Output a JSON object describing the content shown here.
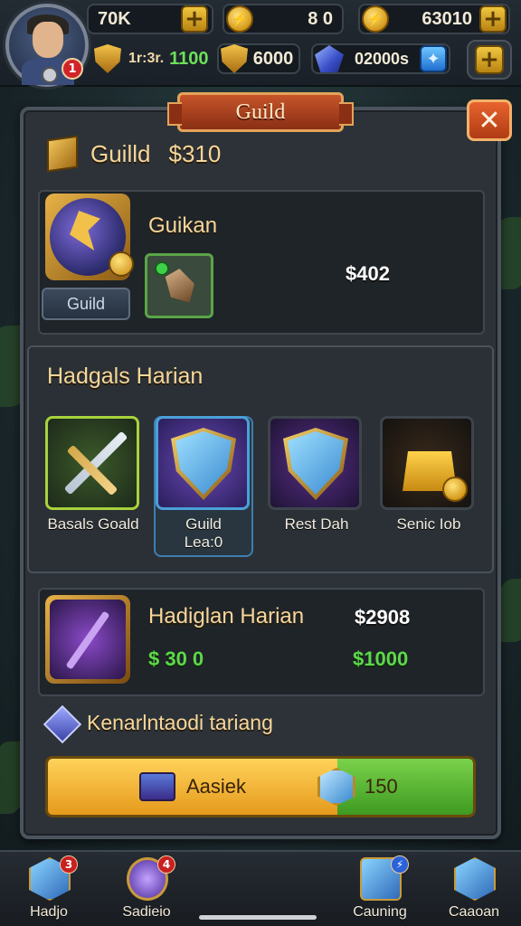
{
  "topbar": {
    "avatar_badge": "1",
    "coins_left": "70K",
    "center_value": "8 0",
    "right_value": "63010",
    "row2_left": "1r:3r.",
    "row2_left_green": "1100",
    "row2_mid": "6000",
    "row2_right": "02000s"
  },
  "panel": {
    "title": "Guild",
    "close_glyph": "✕",
    "guild_name": "Guilld",
    "guild_amount": "$310",
    "guild_sub_name": "Guikan",
    "guild_button": "Guild",
    "guild_value": "$402",
    "section_title": "Hadgals Harian",
    "rewards": [
      {
        "label": "Basals Goald"
      },
      {
        "label": "Guild",
        "sub": "Lea:0"
      },
      {
        "label": "Rest Dah"
      },
      {
        "label": "Senic Iob"
      }
    ],
    "daily": {
      "title": "Hadiglan Harian",
      "price": "$2908",
      "green_left": "$ 30  0",
      "green_right": "$1000"
    },
    "sub_heading": "Kenarlntaodi tariang",
    "action": {
      "label": "Aasiek",
      "right_value": "150"
    }
  },
  "nav": [
    {
      "label": "Hadjo",
      "badge": "3"
    },
    {
      "label": "Sadieio",
      "badge": "4"
    },
    {
      "label": "Cauning",
      "badge": "⚡"
    },
    {
      "label": "Caaoan",
      "badge": ""
    }
  ],
  "colors": {
    "accent_gold": "#f6d69a",
    "title_plate": "#c6552a",
    "action_yellow": "#ffd25a",
    "action_green": "#7ad24a"
  }
}
